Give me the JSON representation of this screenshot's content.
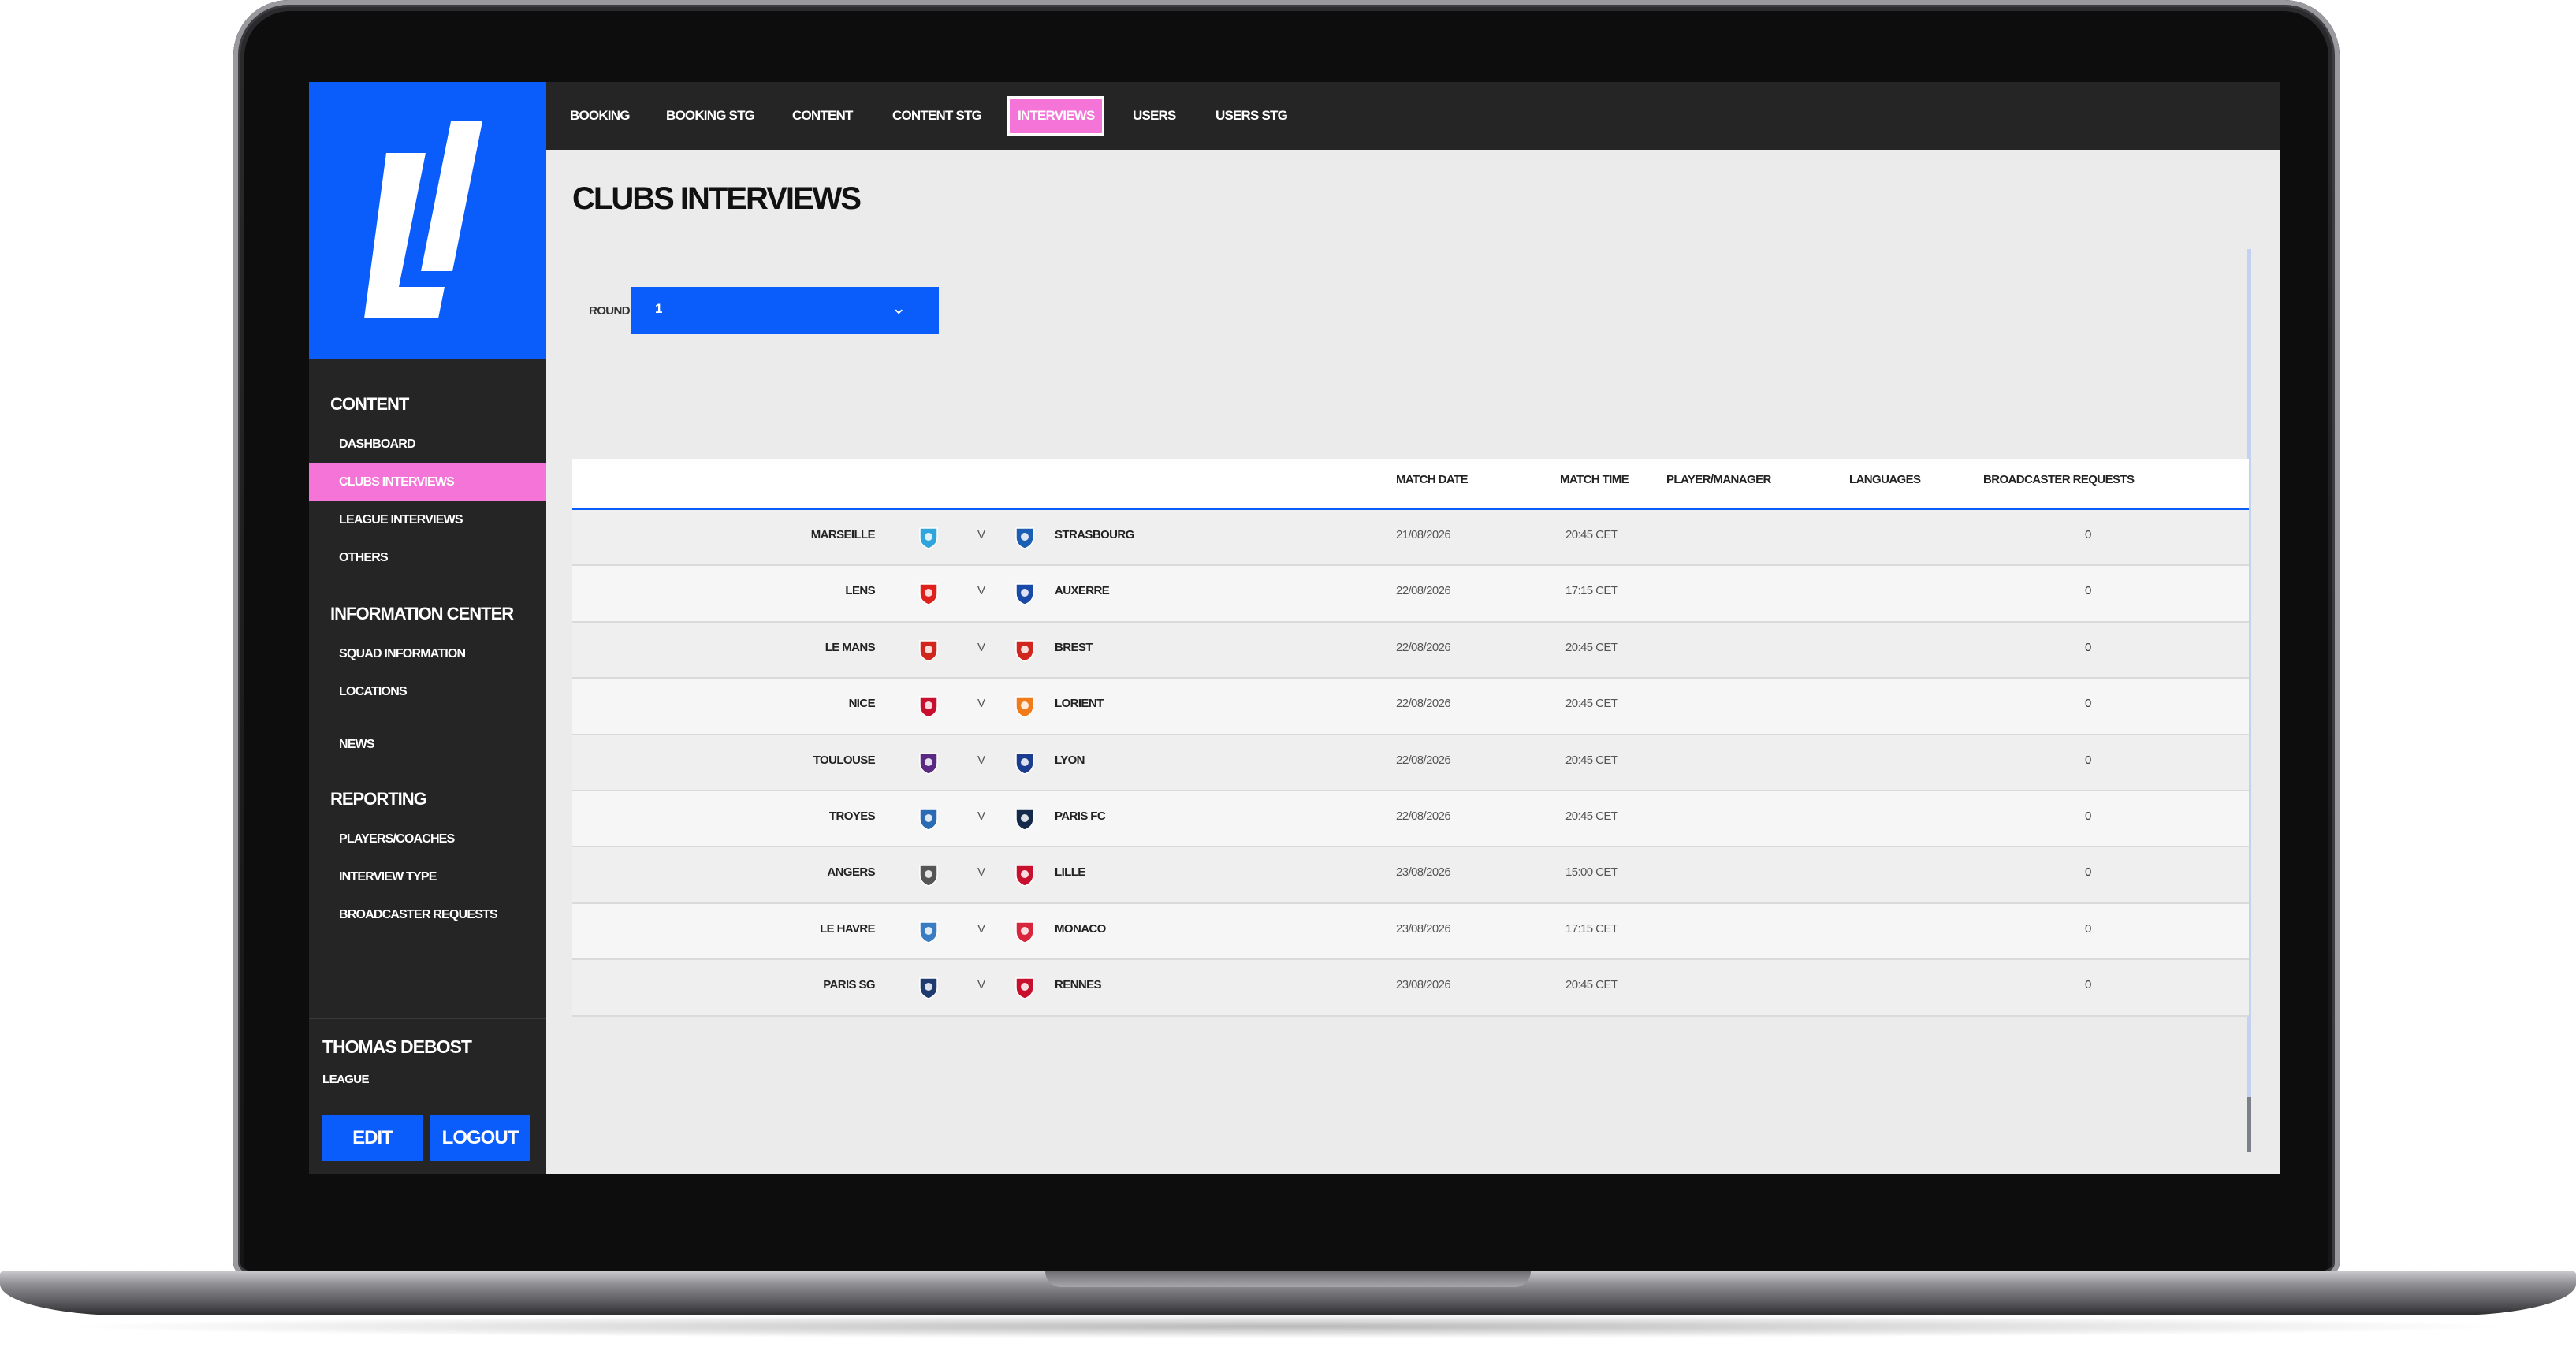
{
  "nav": {
    "tabs": [
      {
        "label": "BOOKING",
        "active": false
      },
      {
        "label": "BOOKING STG",
        "active": false
      },
      {
        "label": "CONTENT",
        "active": false
      },
      {
        "label": "CONTENT STG",
        "active": false
      },
      {
        "label": "INTERVIEWS",
        "active": true
      },
      {
        "label": "USERS",
        "active": false
      },
      {
        "label": "USERS STG",
        "active": false
      }
    ]
  },
  "sidebar": {
    "sections": [
      {
        "title": "CONTENT",
        "items": [
          "DASHBOARD",
          "CLUBS INTERVIEWS",
          "LEAGUE INTERVIEWS",
          "OTHERS"
        ]
      },
      {
        "title": "INFORMATION CENTER",
        "items": [
          "SQUAD INFORMATION",
          "LOCATIONS",
          "NEWS"
        ]
      },
      {
        "title": "REPORTING",
        "items": [
          "PLAYERS/COACHES",
          "INTERVIEW TYPE",
          "BROADCASTER REQUESTS"
        ]
      }
    ],
    "active_item": "CLUBS INTERVIEWS",
    "user": {
      "name": "THOMAS DEBOST",
      "role": "LEAGUE"
    },
    "edit_label": "EDIT",
    "logout_label": "LOGOUT"
  },
  "page": {
    "title": "CLUBS INTERVIEWS",
    "round_label": "ROUND",
    "round_value": "1"
  },
  "table": {
    "headers": [
      "MATCH DATE",
      "MATCH TIME",
      "PLAYER/MANAGER",
      "LANGUAGES",
      "BROADCASTER REQUESTS"
    ],
    "vs_label": "V",
    "rows": [
      {
        "home": "MARSEILLE",
        "away": "STRASBOURG",
        "date": "21/08/2026",
        "time": "20:45 CET",
        "requests": "0",
        "home_color": "#2fa4dd",
        "away_color": "#1b5fb5"
      },
      {
        "home": "LENS",
        "away": "AUXERRE",
        "date": "22/08/2026",
        "time": "17:15 CET",
        "requests": "0",
        "home_color": "#e0201b",
        "away_color": "#1a4aa8"
      },
      {
        "home": "LE MANS",
        "away": "BREST",
        "date": "22/08/2026",
        "time": "20:45 CET",
        "requests": "0",
        "home_color": "#d0261e",
        "away_color": "#d0261e"
      },
      {
        "home": "NICE",
        "away": "LORIENT",
        "date": "22/08/2026",
        "time": "20:45 CET",
        "requests": "0",
        "home_color": "#c8102e",
        "away_color": "#f07b18"
      },
      {
        "home": "TOULOUSE",
        "away": "LYON",
        "date": "22/08/2026",
        "time": "20:45 CET",
        "requests": "0",
        "home_color": "#5a2a82",
        "away_color": "#1b3d8f"
      },
      {
        "home": "TROYES",
        "away": "PARIS FC",
        "date": "22/08/2026",
        "time": "20:45 CET",
        "requests": "0",
        "home_color": "#2a6bb3",
        "away_color": "#152a4a"
      },
      {
        "home": "ANGERS",
        "away": "LILLE",
        "date": "23/08/2026",
        "time": "15:00 CET",
        "requests": "0",
        "home_color": "#555555",
        "away_color": "#c8102e"
      },
      {
        "home": "LE HAVRE",
        "away": "MONACO",
        "date": "23/08/2026",
        "time": "17:15 CET",
        "requests": "0",
        "home_color": "#3a7cc2",
        "away_color": "#d7263d"
      },
      {
        "home": "PARIS SG",
        "away": "RENNES",
        "date": "23/08/2026",
        "time": "20:45 CET",
        "requests": "0",
        "home_color": "#1f3a6e",
        "away_color": "#c8102e"
      }
    ]
  },
  "colors": {
    "accent": "#0b5dfb",
    "highlight": "#f574d8",
    "dark": "#252525"
  }
}
